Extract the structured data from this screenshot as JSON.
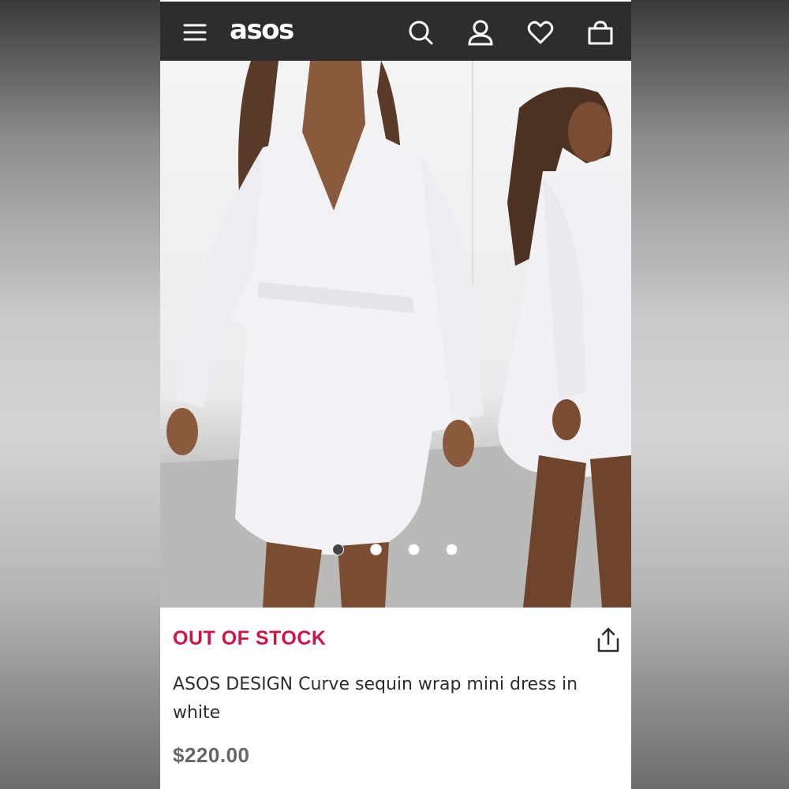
{
  "header": {
    "logo": "asos",
    "icons": [
      "menu-icon",
      "search-icon",
      "account-icon",
      "heart-icon",
      "bag-icon"
    ],
    "background": "#2d2d2d"
  },
  "gallery": {
    "image_description": "",
    "dots_count": 4,
    "active_index": 0
  },
  "product": {
    "stock_status": "OUT OF STOCK",
    "stock_color": "#d01345",
    "title": "ASOS DESIGN Curve sequin wrap mini dress in white",
    "price": "$220.00"
  }
}
